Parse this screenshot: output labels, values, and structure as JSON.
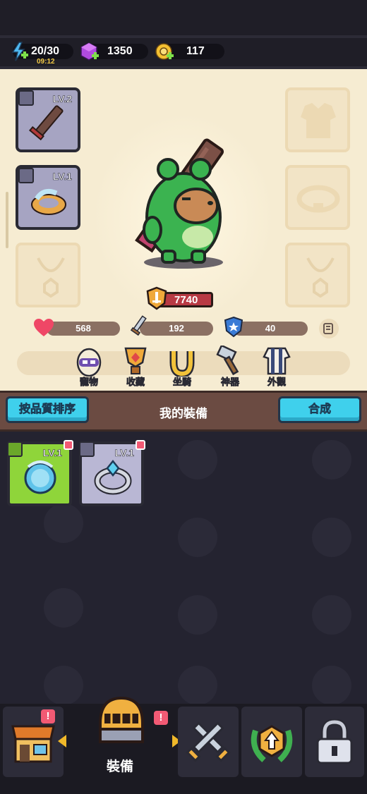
{
  "resources": {
    "energy": {
      "value": "20/30",
      "timer": "09:12",
      "icon": "lightning-icon"
    },
    "gems": {
      "value": "1350",
      "icon": "purple-gem-icon"
    },
    "coins": {
      "value": "117",
      "icon": "gold-key-coin-icon"
    }
  },
  "equipment_slots": {
    "left": [
      {
        "name": "weapon",
        "level": "LV.2",
        "icon": "sword-icon"
      },
      {
        "name": "ring",
        "level": "LV.1",
        "icon": "ring-icon"
      },
      {
        "name": "necklace",
        "level": "",
        "icon": "necklace-placeholder-icon"
      }
    ],
    "right": [
      {
        "name": "armor",
        "icon": "armor-placeholder-icon"
      },
      {
        "name": "belt",
        "icon": "belt-placeholder-icon"
      },
      {
        "name": "amulet",
        "icon": "amulet-placeholder-icon"
      }
    ]
  },
  "power": {
    "value": "7740",
    "icon": "power-shield-icon"
  },
  "stats": {
    "hp": {
      "value": "568",
      "icon": "heart-icon"
    },
    "attack": {
      "value": "192",
      "icon": "sword-icon"
    },
    "defense": {
      "value": "40",
      "icon": "shield-icon"
    }
  },
  "tabs": [
    {
      "label": "寵物",
      "icon": "pet-egg-icon"
    },
    {
      "label": "收藏",
      "icon": "trophy-icon"
    },
    {
      "label": "坐騎",
      "icon": "horseshoe-icon"
    },
    {
      "label": "神器",
      "icon": "hammer-icon"
    },
    {
      "label": "外觀",
      "icon": "outfit-icon"
    }
  ],
  "inventory": {
    "sort_button": "按品質排序",
    "title": "我的裝備",
    "merge_button": "合成",
    "items": [
      {
        "level": "LV.1",
        "icon": "blue-orb-necklace-icon",
        "rarity_color": "#8fd53a"
      },
      {
        "level": "LV.1",
        "icon": "crystal-ring-icon",
        "rarity_color": "#b9b7d4"
      }
    ]
  },
  "bottom_nav": {
    "active_label": "裝備",
    "items": [
      {
        "name": "shop",
        "icon": "shop-icon",
        "badge": "!"
      },
      {
        "name": "equipment",
        "icon": "knight-helmet-icon",
        "badge": "!"
      },
      {
        "name": "battle",
        "icon": "crossed-swords-icon"
      },
      {
        "name": "upgrade",
        "icon": "laurel-upgrade-icon"
      },
      {
        "name": "locked",
        "icon": "lock-icon"
      }
    ]
  },
  "colors": {
    "panel_bg": "#f6ecd2",
    "accent_blue": "#3fd0ec",
    "badge_red": "#f25a74",
    "power_red": "#b83a44"
  }
}
